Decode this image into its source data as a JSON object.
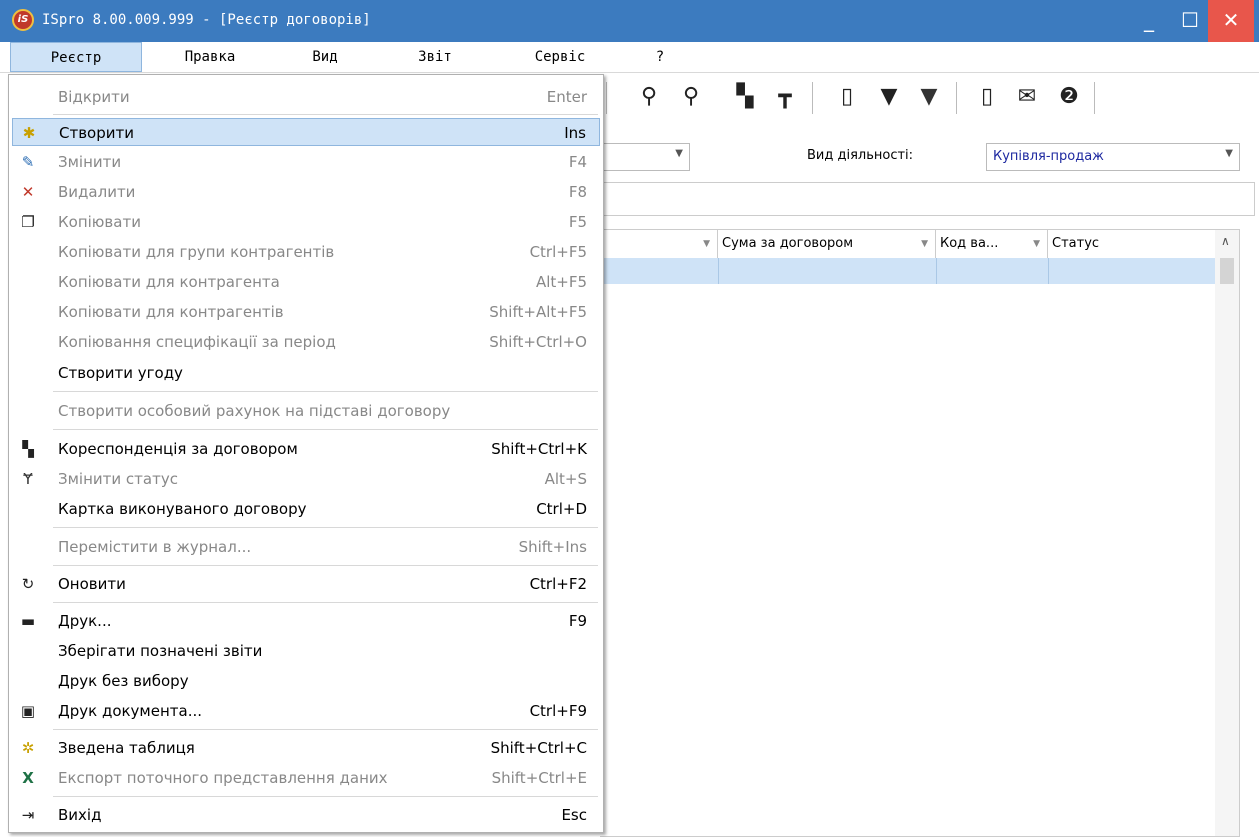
{
  "window": {
    "title": "ISpro 8.00.009.999 - [Реєстр договорів]",
    "logo_text": "iS",
    "minimize": "_",
    "maximize": "☐",
    "close": "✕"
  },
  "menubar": [
    "Реєстр",
    "Правка",
    "Вид",
    "Звіт",
    "Сервіс",
    "?"
  ],
  "toolbar": {
    "icons": [
      "search-icon",
      "find-next-icon",
      "correspondence-icon",
      "hierarchy-icon",
      "document-clock-icon",
      "filter-icon",
      "clear-filter-icon",
      "form-icon",
      "mail-icon",
      "help-icon"
    ]
  },
  "filters": {
    "activity_label": "Вид діяльності:",
    "activity_value": "Купівля-продаж"
  },
  "grid": {
    "columns": [
      "",
      "Сума за договором",
      "Код ва...",
      "Статус"
    ]
  },
  "menu": {
    "items": [
      {
        "label": "Відкрити",
        "shortcut": "Enter",
        "enabled": false,
        "icon": ""
      },
      {
        "label": "Створити",
        "shortcut": "Ins",
        "enabled": true,
        "selected": true,
        "icon": "create-icon"
      },
      {
        "label": "Змінити",
        "shortcut": "F4",
        "enabled": false,
        "icon": "edit-icon"
      },
      {
        "label": "Видалити",
        "shortcut": "F8",
        "enabled": false,
        "icon": "delete-icon"
      },
      {
        "label": "Копіювати",
        "shortcut": "F5",
        "enabled": false,
        "icon": "copy-icon"
      },
      {
        "label": "Копіювати для групи контрагентів",
        "shortcut": "Ctrl+F5",
        "enabled": false,
        "icon": ""
      },
      {
        "label": "Копіювати для контрагента",
        "shortcut": "Alt+F5",
        "enabled": false,
        "icon": ""
      },
      {
        "label": "Копіювати для контрагентів",
        "shortcut": "Shift+Alt+F5",
        "enabled": false,
        "icon": ""
      },
      {
        "label": "Копіювання специфікації за період",
        "shortcut": "Shift+Ctrl+O",
        "enabled": false,
        "icon": ""
      },
      {
        "label": "Створити угоду",
        "shortcut": "",
        "enabled": true,
        "icon": ""
      },
      {
        "label": "Створити особовий рахунок на підставі договору",
        "shortcut": "",
        "enabled": false,
        "icon": ""
      },
      {
        "label": "Кореспонденція за договором",
        "shortcut": "Shift+Ctrl+K",
        "enabled": true,
        "icon": "correspondence-icon"
      },
      {
        "label": "Змінити статус",
        "shortcut": "Alt+S",
        "enabled": false,
        "icon": "status-icon"
      },
      {
        "label": "Картка виконуваного договору",
        "shortcut": "Ctrl+D",
        "enabled": true,
        "icon": ""
      },
      {
        "label": "Перемістити в журнал...",
        "shortcut": "Shift+Ins",
        "enabled": false,
        "icon": ""
      },
      {
        "label": "Оновити",
        "shortcut": "Ctrl+F2",
        "enabled": true,
        "icon": "refresh-icon"
      },
      {
        "label": "Друк...",
        "shortcut": "F9",
        "enabled": true,
        "icon": "print-icon"
      },
      {
        "label": "Зберігати позначені звіти",
        "shortcut": "",
        "enabled": true,
        "icon": ""
      },
      {
        "label": "Друк без вибору",
        "shortcut": "",
        "enabled": true,
        "icon": ""
      },
      {
        "label": "Друк документа...",
        "shortcut": "Ctrl+F9",
        "enabled": true,
        "icon": "print-document-icon"
      },
      {
        "label": "Зведена таблиця",
        "shortcut": "Shift+Ctrl+C",
        "enabled": true,
        "icon": "pivot-table-icon"
      },
      {
        "label": "Експорт поточного представлення даних",
        "shortcut": "Shift+Ctrl+E",
        "enabled": false,
        "icon": "excel-export-icon"
      },
      {
        "label": "Вихід",
        "shortcut": "Esc",
        "enabled": true,
        "icon": "exit-icon"
      }
    ]
  },
  "colors": {
    "titlebar": "#3c7bbf",
    "selection": "#cfe3f7",
    "close_button": "#e8564b",
    "combo_text": "#1d28a0"
  }
}
